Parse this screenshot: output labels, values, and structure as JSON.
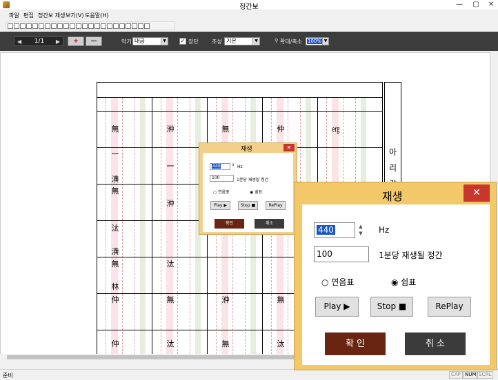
{
  "window": {
    "title": "정간보",
    "minimize": "—",
    "maximize": "▢",
    "close": "✕"
  },
  "menu": {
    "items": [
      "파일",
      "편집",
      "정간보 재생",
      "보기(V)",
      "도움말(H)"
    ]
  },
  "navbar": {
    "prev": "◀",
    "next": "▶",
    "page": "1/1",
    "add_page": "+",
    "remove_page": "—",
    "instrument_label": "악기",
    "instrument_value": "대금",
    "jangdan_label": "장단",
    "jangdan_checked": "✓",
    "key_label": "조성",
    "key_value": "기본",
    "zoom_label": "확대/축소",
    "zoom_value": "100%",
    "dropdown": "▼"
  },
  "score": {
    "side_title": [
      "아",
      "리",
      "랑"
    ],
    "symbols": [
      "無",
      "㳞",
      "無",
      "仲",
      "㋍",
      "一",
      "一",
      "潢",
      "無",
      "㳞",
      "汰",
      "潢",
      "無",
      "汰",
      "林",
      "仲",
      "無",
      "㳞",
      "無",
      "仲",
      "汰",
      "無",
      "汰"
    ]
  },
  "status": {
    "ready": "준비",
    "cap": "CAP",
    "num": "NUM",
    "scrl": "SCRL"
  },
  "dialog_small": {
    "title": "재생",
    "close": "✕",
    "frequency": "440",
    "frequency_unit": "Hz",
    "tempo": "100",
    "tempo_label": "1분당 재생될 정간",
    "radio_legato": "연음표",
    "radio_rest": "쉼표",
    "play": "Play ▶",
    "stop": "Stop ■",
    "replay": "RePlay",
    "ok": "확인",
    "cancel": "취소"
  },
  "dialog_large": {
    "title": "재생",
    "close": "✕",
    "frequency": "440",
    "frequency_unit": "Hz",
    "tempo": "100",
    "tempo_label": "1분당 재생될 정간",
    "radio_legato": "연음표",
    "radio_rest": "쉼표",
    "play": "Play ▶",
    "stop": "Stop ■",
    "replay": "RePlay",
    "ok": "확 인",
    "cancel": "취 소"
  }
}
